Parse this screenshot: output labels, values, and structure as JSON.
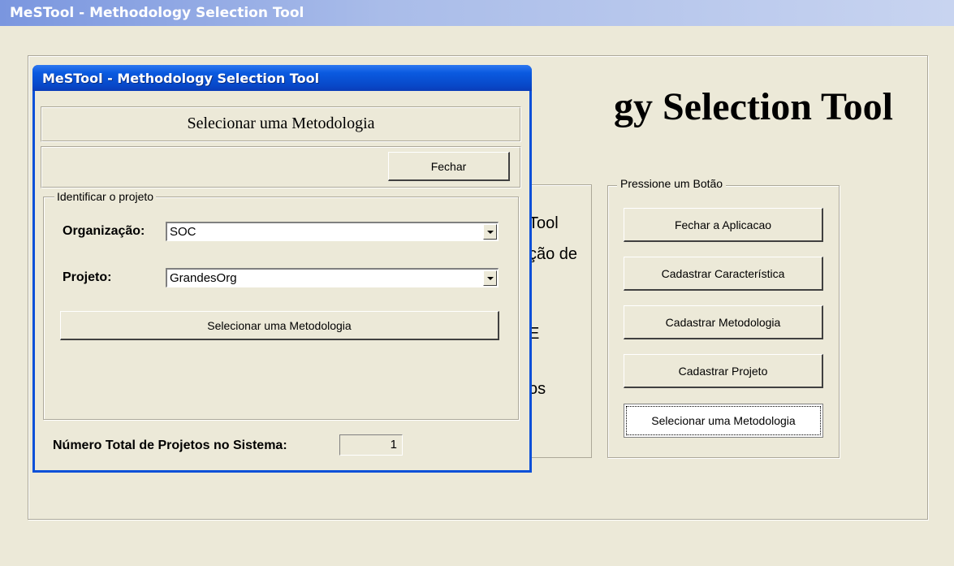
{
  "main_window": {
    "title": "MeSTool - Methodology Selection Tool",
    "heading_visible": "gy Selection Tool",
    "description_fragments": [
      "Tool",
      "ção de",
      "E",
      "os"
    ],
    "button_group": {
      "legend": "Pressione um Botão",
      "buttons": [
        "Fechar a Aplicacao",
        "Cadastrar Característica",
        "Cadastrar Metodologia",
        "Cadastrar Projeto",
        "Selecionar uma Metodologia"
      ]
    }
  },
  "dialog": {
    "title": "MeSTool - Methodology Selection Tool",
    "header": "Selecionar uma Metodologia",
    "close_label": "Fechar",
    "group_legend": "Identificar o projeto",
    "organization": {
      "label": "Organização:",
      "value": "SOC"
    },
    "project": {
      "label": "Projeto:",
      "value": "GrandesOrg"
    },
    "select_button": "Selecionar uma Metodologia",
    "total_projects": {
      "label": "Número Total de Projetos no Sistema:",
      "value": "1"
    }
  },
  "colors": {
    "dialog_titlebar": "#0a5ae0",
    "inactive_titlebar": "#a9bce9",
    "window_bg": "#ece9d8"
  }
}
